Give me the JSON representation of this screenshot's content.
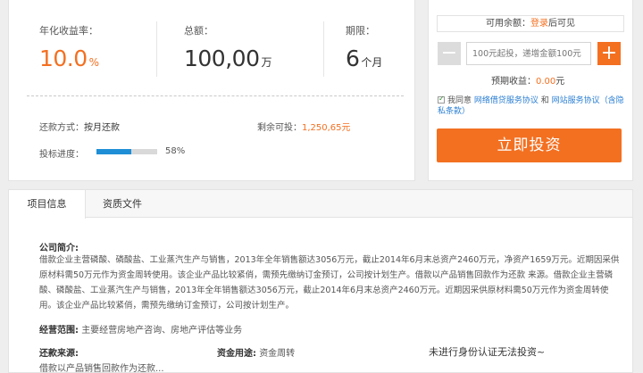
{
  "summary": {
    "rate_label": "年化收益率：",
    "rate_value": "10.0",
    "rate_unit": "%",
    "amount_label": "总额：",
    "amount_value": "100,00",
    "amount_unit": "万",
    "term_label": "期限：",
    "term_value": "6",
    "term_unit": "个月",
    "repay_label": "还款方式：",
    "repay_value": "按月还款",
    "remaining_label": "剩余可投：",
    "remaining_value": "1,250,65元",
    "progress_label": "投标进度：",
    "progress_value": 0.58,
    "progress_text": "58%"
  },
  "invest": {
    "balance_prefix": "可用余额：",
    "balance_login": "登录",
    "balance_suffix": "后可见",
    "minus_label": "−",
    "plus_label": "+",
    "amount_placeholder": "100元起投，递增金额100元",
    "expected_label": "预期收益：",
    "expected_value": "0.00",
    "expected_unit": "元",
    "agree_prefix": "我同意",
    "agree_link1": "网络借贷服务协议",
    "agree_and": "和",
    "agree_link2": "网站服务协议（含隐私条款）",
    "button_label": "立即投资"
  },
  "details": {
    "tabs": [
      "项目信息",
      "资质文件"
    ],
    "intro_title": "公司简介:",
    "intro_text": "借款企业主营磷酸、磷酸盐、工业蒸汽生产与销售，2013年全年销售额达3056万元，截止2014年6月末总资产2460万元，净资产1659万元。近期因采供原材料需50万元作为资金周转使用。该企业产品比较紧俏，需预先缴纳订金预订，公司按计划生产。借款以产品销售回款作为还款 来源。借款企业主营磷酸、磷酸盐、工业蒸汽生产与销售，2013年全年销售额达3056万元，截止2014年6月末总资产2460万元。近期因采供原材料需50万元作为资金周转使用。该企业产品比较紧俏，需预先缴纳订金预订，公司按计划生产。",
    "scope_label": "经营范围:",
    "scope_value": "主要经营房地产咨询、房地产评估等业务",
    "source_label": "还款来源:",
    "source_value": "借款以产品销售回款作为还款...",
    "usage_label": "资金用途:",
    "usage_value": "资金周转",
    "notice": "未进行身份认证无法投资~"
  }
}
